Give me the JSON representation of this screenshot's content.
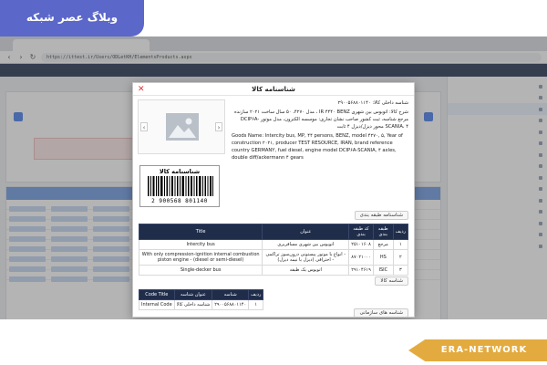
{
  "watermark": {
    "badge_text": "وبلاگ عصر شبکه",
    "ribbon_text": "ERA-NETWORK"
  },
  "browser": {
    "url": "https://ittest.ir/Users/ODLetKH/ElementsProducts.aspx"
  },
  "modal": {
    "title": "شناسنامه کالا",
    "barcode": {
      "title": "شناسنامه کالا",
      "number": "2 900568 801140"
    },
    "info_lines": [
      "شناسه داخلی کالا: ۲۹۰۰۵۶۸۸۰۱۱۴۰",
      "شرح کالا: اتوبوس بین شهری IR ۴۴۴۰ BENZ ، مدل ۴۲۷۰، ۵۰ سال ساخت ۲۰۲۱ سازنده مرجع شناسه، ثبت کشور صاحب نشان تجاری: موسسه الکترون، مدل موتور DCIP۶A-SCANIA، ۴ محور دیزل/دیزل ۴ ثابت",
      "Goods Name: Intercity bus, MP, ۴۴ persons, BENZ, model ۴۲۷۰, ۵, Year of construction ۲۰۲۱, producer TEST RESOURCE, IRAN, brand reference country GERMANY, fuel diesel, engine model DCIP۶A-SCANIA, ۴ axles, double diff/ackermann ۴ gears"
    ],
    "section_classification": "شناسنامه طبقه بندی",
    "classification_table": {
      "headers": [
        "ردیف",
        "طبقه بندی",
        "کد طبقه بندی",
        "عنوان",
        "Title"
      ],
      "rows": [
        [
          "۱",
          "مرجع",
          "۲۵۱۰۱۶۰۸",
          "اتوبوس بین شهری مسافربری",
          "Intercity bus"
        ],
        [
          "۲",
          "HS",
          "۸۷۰۲۱۰۰۰",
          "- انواع با موتور پیستونی درون‌سوز تراکمی - احتراقی (دیزل یا نیمه دیزل)",
          "With only compression-ignition internal combustion piston engine - (diesel or semi-diesel)"
        ],
        [
          "۳",
          "ISIC",
          "۲۹۱۰۴۶۱۹",
          "اتوبوس یک طبقه",
          "Single-decker bus"
        ]
      ]
    },
    "section_code": "شناسه کالا",
    "code_table": {
      "headers": [
        "ردیف",
        "شناسه",
        "عنوان شناسه",
        "Code Title"
      ],
      "rows": [
        [
          "۱",
          "۲۹۰۰۵۶۸۸۰۱۱۴۰",
          "شناسه داخلی کالا",
          "Internal Code"
        ]
      ]
    },
    "section_org": "شناسه های سازمانی"
  },
  "colors": {
    "header_dark": "#1f2d4a",
    "badge": "#5b67c9",
    "ribbon": "#e3ab3f",
    "close": "#dd3333"
  },
  "icons": {
    "close": "close-icon",
    "prev": "chevron-left-icon",
    "next": "chevron-right-icon",
    "image": "image-placeholder-icon",
    "barcode": "barcode-icon"
  }
}
